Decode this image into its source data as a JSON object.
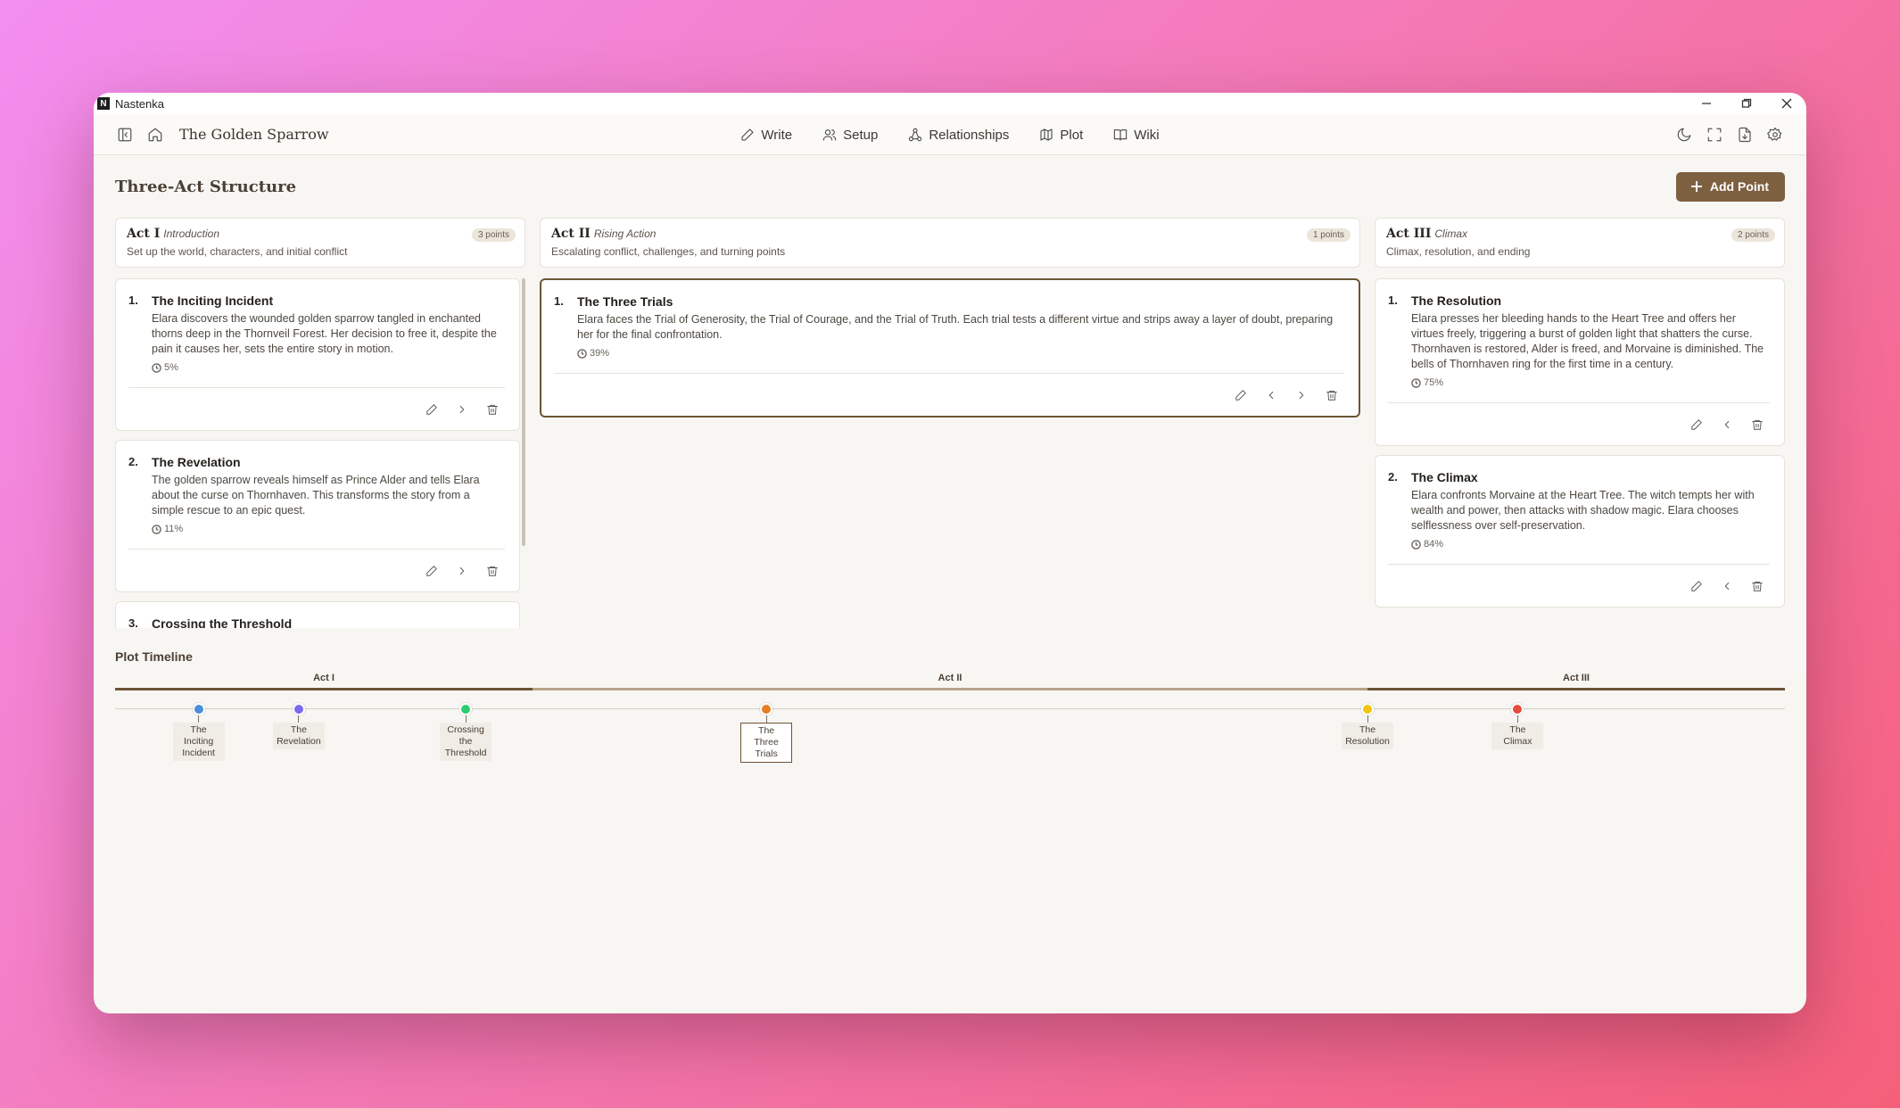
{
  "window": {
    "app_name": "Nastenka"
  },
  "toolbar": {
    "project_title": "The Golden Sparrow",
    "nav": [
      {
        "label": "Write",
        "icon": "pen-icon"
      },
      {
        "label": "Setup",
        "icon": "users-icon"
      },
      {
        "label": "Relationships",
        "icon": "network-icon"
      },
      {
        "label": "Plot",
        "icon": "map-icon"
      },
      {
        "label": "Wiki",
        "icon": "book-icon"
      }
    ]
  },
  "page": {
    "title": "Three-Act Structure",
    "add_button": "Add Point"
  },
  "acts": [
    {
      "name": "Act I",
      "subtitle": "Introduction",
      "badge": "3 points",
      "description": "Set up the world, characters, and initial conflict",
      "cards": [
        {
          "num": "1.",
          "title": "The Inciting Incident",
          "text": "Elara discovers the wounded golden sparrow tangled in enchanted thorns deep in the Thornveil Forest. Her decision to free it, despite the pain it causes her, sets the entire story in motion.",
          "pct": "5%"
        },
        {
          "num": "2.",
          "title": "The Revelation",
          "text": "The golden sparrow reveals himself as Prince Alder and tells Elara about the curse on Thornhaven. This transforms the story from a simple rescue to an epic quest.",
          "pct": "11%"
        },
        {
          "num": "3.",
          "title": "Crossing the Threshold",
          "text": "",
          "pct": ""
        }
      ]
    },
    {
      "name": "Act II",
      "subtitle": "Rising Action",
      "badge": "1 points",
      "description": "Escalating conflict, challenges, and turning points",
      "cards": [
        {
          "num": "1.",
          "title": "The Three Trials",
          "text": "Elara faces the Trial of Generosity, the Trial of Courage, and the Trial of Truth. Each trial tests a different virtue and strips away a layer of doubt, preparing her for the final confrontation.",
          "pct": "39%"
        }
      ]
    },
    {
      "name": "Act III",
      "subtitle": "Climax",
      "badge": "2 points",
      "description": "Climax, resolution, and ending",
      "cards": [
        {
          "num": "1.",
          "title": "The Resolution",
          "text": "Elara presses her bleeding hands to the Heart Tree and offers her virtues freely, triggering a burst of golden light that shatters the curse. Thornhaven is restored, Alder is freed, and Morvaine is diminished. The bells of Thornhaven ring for the first time in a century.",
          "pct": "75%"
        },
        {
          "num": "2.",
          "title": "The Climax",
          "text": "Elara confronts Morvaine at the Heart Tree. The witch tempts her with wealth and power, then attacks with shadow magic. Elara chooses selflessness over self-preservation.",
          "pct": "84%"
        }
      ]
    }
  ],
  "timeline": {
    "title": "Plot Timeline",
    "acts": [
      {
        "label": "Act I",
        "start": 0,
        "end": 25
      },
      {
        "label": "Act II",
        "start": 25,
        "end": 75
      },
      {
        "label": "Act III",
        "start": 75,
        "end": 100
      }
    ],
    "points": [
      {
        "label": "The Inciting Incident",
        "pct": 5,
        "color": "#4a90d9"
      },
      {
        "label": "The Revelation",
        "pct": 11,
        "color": "#7b68ee"
      },
      {
        "label": "Crossing the Threshold",
        "pct": 21,
        "color": "#2ecc71"
      },
      {
        "label": "The Three Trials",
        "pct": 39,
        "color": "#e67e22",
        "selected": true
      },
      {
        "label": "The Resolution",
        "pct": 75,
        "color": "#f1c40f"
      },
      {
        "label": "The Climax",
        "pct": 84,
        "color": "#e74c3c"
      }
    ]
  }
}
